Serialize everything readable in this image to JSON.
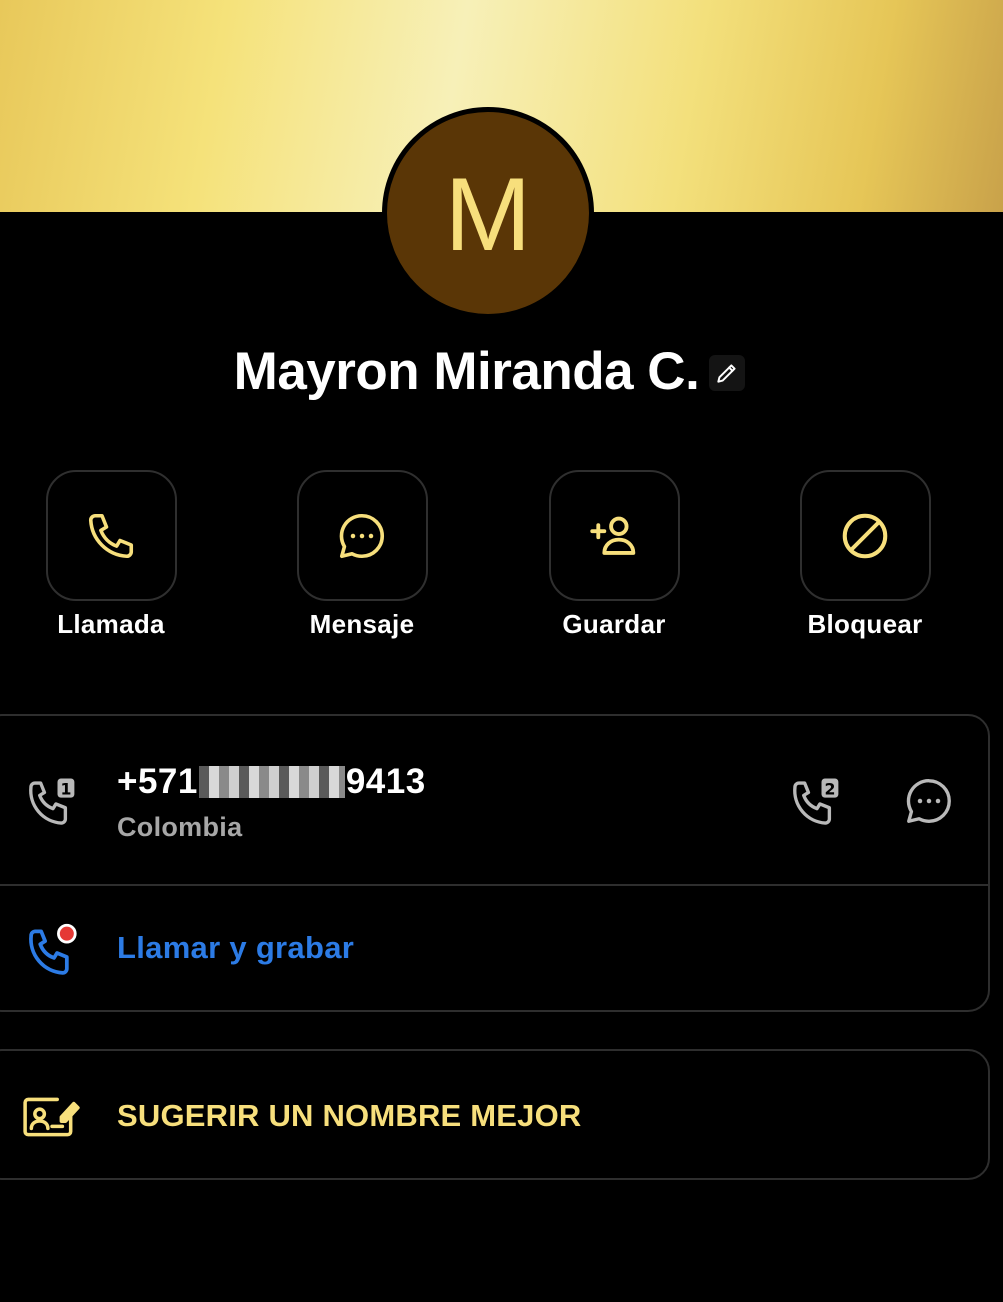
{
  "contact": {
    "initial": "M",
    "name": "Mayron Miranda C."
  },
  "actions": [
    {
      "label": "Llamada",
      "icon": "phone-icon"
    },
    {
      "label": "Mensaje",
      "icon": "chat-bubble-icon"
    },
    {
      "label": "Guardar",
      "icon": "add-person-icon"
    },
    {
      "label": "Bloquear",
      "icon": "block-icon"
    }
  ],
  "phone": {
    "prefix": "+571",
    "suffix": "9413",
    "country": "Colombia"
  },
  "call_record": {
    "label": "Llamar y grabar"
  },
  "suggest": {
    "label": "SUGERIR UN NOMBRE MEJOR"
  },
  "colors": {
    "accent_gold": "#f7df7c",
    "avatar_bg": "#5a3606",
    "record_blue": "#2c7be5",
    "record_dot": "#e53935",
    "card_border": "#2e2e2e"
  }
}
